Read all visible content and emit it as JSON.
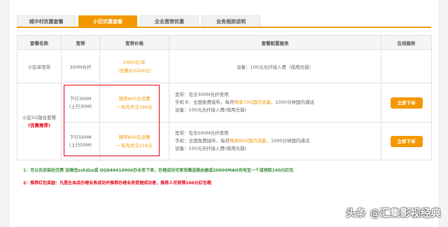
{
  "tabs": [
    {
      "label": "城中村优惠套餐",
      "active": false
    },
    {
      "label": "小区优惠套餐",
      "active": true
    },
    {
      "label": "企业宽带优惠",
      "active": false
    },
    {
      "label": "业务规则说明",
      "active": false
    }
  ],
  "table": {
    "headers": [
      "套餐名称",
      "宽带",
      "宽带价格",
      "套餐配置服务",
      "在线服务"
    ],
    "row1": {
      "name": "小区单宽带",
      "speed": "300M光纤",
      "price": "2400元/年",
      "price_note": "（优惠价2200元）",
      "service": "设备：100元光纤接入费（借用光猫）"
    },
    "group": {
      "name": "小区5G融合套餐",
      "tag": "(优惠推荐)"
    },
    "row2": {
      "speed": "下行300M",
      "speed_up": "(上行30M)",
      "price": "预存600元话费",
      "price_note": "一年内月交189元",
      "service_line1": "宽带：包含300M光纤使用",
      "service_line2_a": "手机卡：全国免费接听，每月",
      "service_line2_b": "畅享70G国内流量",
      "service_line2_c": "、1000分钟国内通话",
      "service_line3": "设备：100元光纤接入费(借用光猫)",
      "button": "立即下单"
    },
    "row3": {
      "speed": "下行500M",
      "speed_up": "(上行50M)",
      "price": "预存600元话费",
      "price_note": "一年内月交219元",
      "service_line1": "宽带：包含500M光纤使用",
      "service_line2_a": "手机：全国免费接听，每月",
      "service_line2_b": "畅享80G国内流量",
      "service_line2_c": "、1000分钟国内通话",
      "service_line3": "设备：100元光纤接入费(借用光猫)",
      "button": "立即下单"
    }
  },
  "notes": {
    "note1": "1：可以先安装后交费  加微信zxkdzx或  QQ846410000办业务下单，办理成功可享受赠送路由器或20000MAH充电宝一个或领取100元红包",
    "note2": "2：推荐红包奖励：凡是在本店办理业务成功并推荐办理业务受理成功者，推荐人可获得100元红包哦"
  },
  "watermark": "头条 @汇集影视经典",
  "colors": {
    "accent": "#f39800",
    "highlight": "#e60012",
    "note_green": "#3a8f3a"
  }
}
